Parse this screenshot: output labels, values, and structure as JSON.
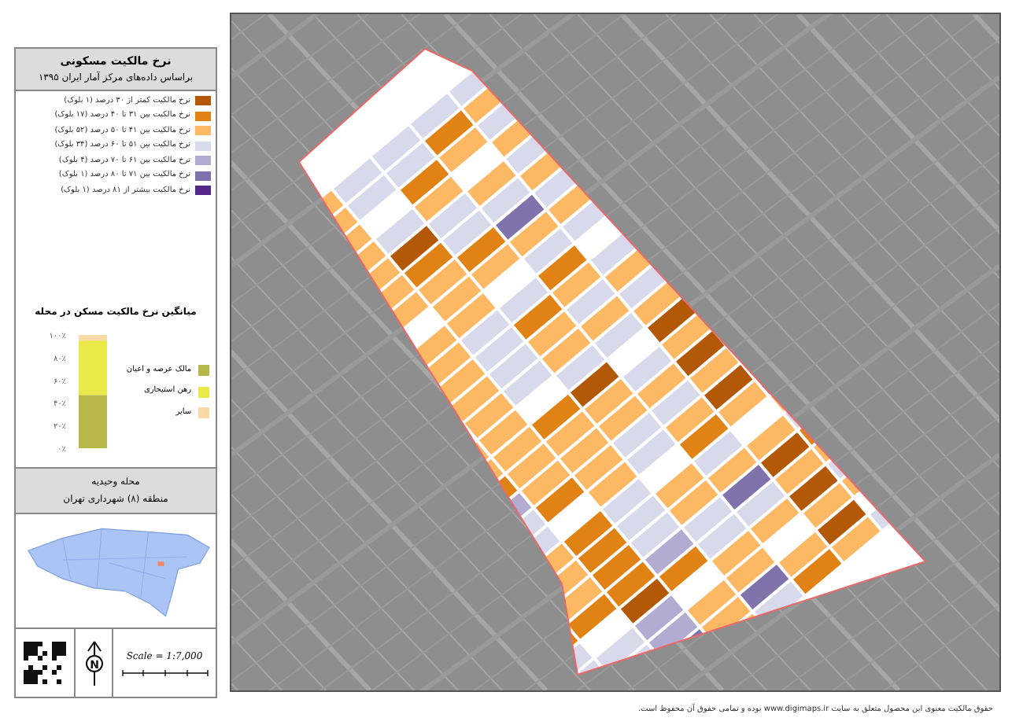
{
  "legend": {
    "title": "نرخ مالکیت مسکونی",
    "subtitle": "براساس داده‌های مرکز آمار ایران ۱۳۹۵",
    "items": [
      {
        "label": "نرخ مالکیت کمتر از ۳۰ درصد (۱ بلوک)",
        "color": "#b35806"
      },
      {
        "label": "نرخ مالکیت بین ۳۱ تا ۴۰ درصد (۱۷ بلوک)",
        "color": "#e08214"
      },
      {
        "label": "نرخ مالکیت بین ۴۱ تا ۵۰ درصد (۵۲ بلوک)",
        "color": "#fdb863"
      },
      {
        "label": "نرخ مالکیت بین ۵۱ تا ۶۰ درصد (۳۴ بلوک)",
        "color": "#d8daeb"
      },
      {
        "label": "نرخ مالکیت بین ۶۱ تا ۷۰ درصد (۴ بلوک)",
        "color": "#b2abd2"
      },
      {
        "label": "نرخ مالکیت بین ۷۱ تا ۸۰ درصد (۱ بلوک)",
        "color": "#8073ac"
      },
      {
        "label": "نرخ مالکیت بیشتر از ۸۱ درصد (۱ بلوک)",
        "color": "#542788"
      }
    ]
  },
  "chart": {
    "chart_data": {
      "type": "bar",
      "title": "میانگین نرخ مالکیت مسکن در محله",
      "stacked": true,
      "legend": "right",
      "ylim": [
        0,
        100
      ],
      "yticks": [
        {
          "value": 0,
          "label": "۰٪"
        },
        {
          "value": 20,
          "label": "۲۰٪"
        },
        {
          "value": 40,
          "label": "۴۰٪"
        },
        {
          "value": 60,
          "label": "۶۰٪"
        },
        {
          "value": 80,
          "label": "۸۰٪"
        },
        {
          "value": 100,
          "label": "۱۰۰٪"
        }
      ],
      "series": [
        {
          "name": "مالک عرصه و اعیان",
          "color": "#b8b84a",
          "values": [
            47
          ]
        },
        {
          "name": "رهن استیجاری",
          "color": "#e9e94a",
          "values": [
            48
          ]
        },
        {
          "name": "سایر",
          "color": "#fdd9a6",
          "values": [
            5
          ]
        }
      ]
    }
  },
  "area": {
    "name": "محله وحیدیه",
    "district": "منطقه (۸) شهرداری تهران"
  },
  "north_arrow": {
    "label": "N"
  },
  "scale": {
    "text": "Scale = 1:7,000"
  },
  "footer": "حقوق مالکیت معنوی این محصول متعلق به سایت www.digimaps.ir بوده و تمامی حقوق آن محفوظ است."
}
